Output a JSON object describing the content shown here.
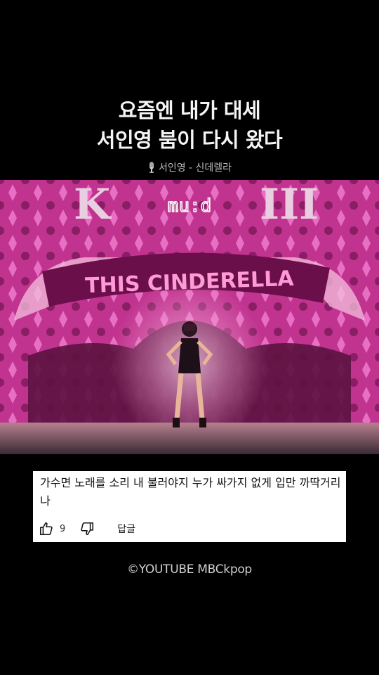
{
  "headline": {
    "line1": "요즘엔 내가 대세",
    "line2": "서인영 붐이 다시 왔다"
  },
  "song": {
    "icon": "microphone-icon",
    "label": "서인영 - 신데렐라"
  },
  "video": {
    "watermark": "mu:d"
  },
  "comment": {
    "text": "가수면 노래를 소리 내 불러야지 누가 싸가지 없게 입만 까딱거리나",
    "like_count": "9",
    "reply_label": "답글"
  },
  "credit": "©YOUTUBE MBCkpop",
  "colors": {
    "background": "#000000",
    "stage_pink": "#d23a9b",
    "comment_bg": "#ffffff"
  }
}
